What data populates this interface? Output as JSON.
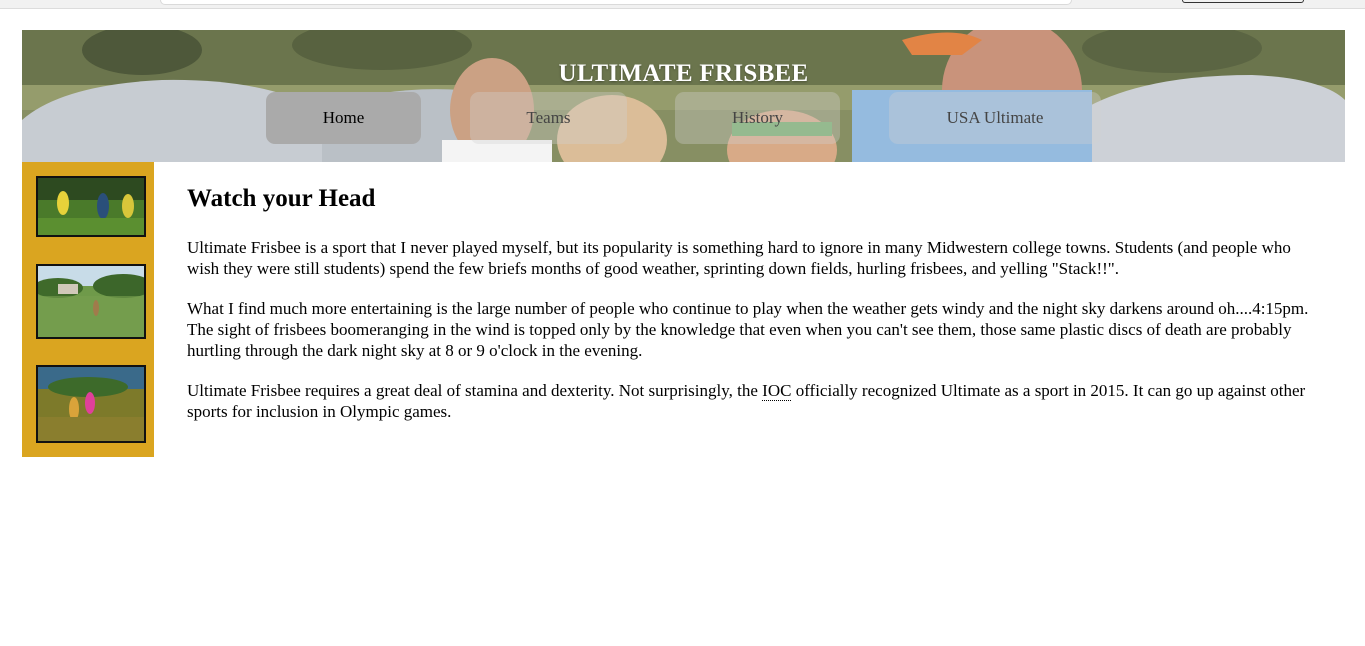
{
  "header": {
    "title": "ULTIMATE FRISBEE"
  },
  "nav": {
    "items": [
      {
        "label": "Home",
        "active": true
      },
      {
        "label": "Teams",
        "active": false
      },
      {
        "label": "History",
        "active": false
      },
      {
        "label": "USA Ultimate",
        "active": false
      }
    ]
  },
  "sidebar": {
    "background": "#daa520",
    "thumbnails": [
      {
        "subject": "frisbee-players-photo"
      },
      {
        "subject": "frisbee-field-photo"
      },
      {
        "subject": "frisbee-game-photo"
      }
    ]
  },
  "main": {
    "heading": "Watch your Head",
    "p1": "Ultimate Frisbee is a sport that I never played myself, but its popularity is something hard to ignore in many Midwestern college towns. Students (and people who wish they were still students) spend the few briefs months of good weather, sprinting down fields, hurling frisbees, and yelling \"Stack!!\".",
    "p2": "What I find much more entertaining is the large number of people who continue to play when the weather gets windy and the night sky darkens around oh....4:15pm. The sight of frisbees boomeranging in the wind is topped only by the knowledge that even when you can't see them, those same plastic discs of death are probably hurtling through the dark night sky at 8 or 9 o'clock in the evening.",
    "p3_before": "Ultimate Frisbee requires a great deal of stamina and dexterity. Not surprisingly, the ",
    "p3_abbr": "IOC",
    "p3_after": " officially recognized Ultimate as a sport in 2015. It can go up against other sports for inclusion in Olympic games."
  }
}
